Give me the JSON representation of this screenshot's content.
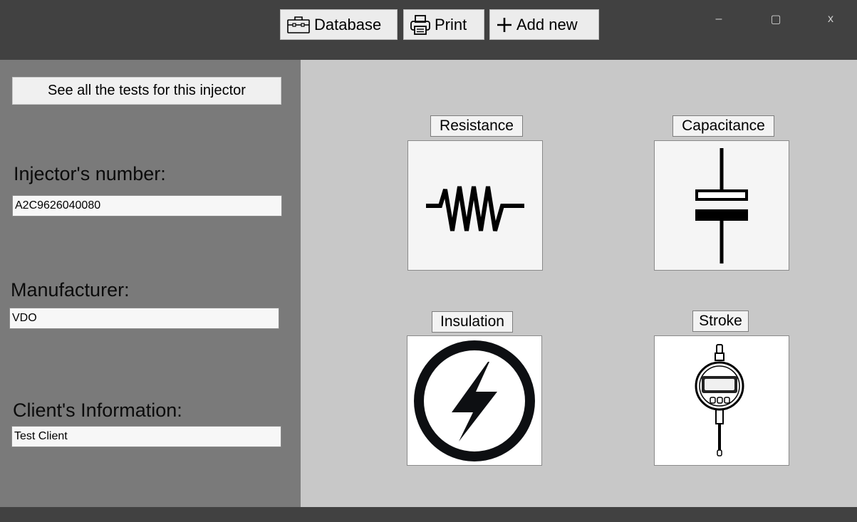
{
  "toolbar": {
    "database_label": "Database",
    "print_label": "Print",
    "add_new_label": "Add new"
  },
  "window_controls": {
    "minimize": "–",
    "maximize": "▢",
    "close": "x"
  },
  "left": {
    "see_all_label": "See all the tests for this injector",
    "injector_label": "Injector's number:",
    "injector_value": "A2C9626040080",
    "manufacturer_label": "Manufacturer:",
    "manufacturer_value": "VDO",
    "client_label": "Client's Information:",
    "client_value": "Test Client"
  },
  "tests": {
    "resistance": {
      "label": "Resistance",
      "icon": "resistor-icon"
    },
    "capacitance": {
      "label": "Capacitance",
      "icon": "capacitor-icon"
    },
    "insulation": {
      "label": "Insulation",
      "icon": "lightning-circle-icon"
    },
    "stroke": {
      "label": "Stroke",
      "icon": "dial-indicator-icon"
    }
  },
  "colors": {
    "titlebar": "#414141",
    "left_panel": "#7a7a7a",
    "right_panel": "#c8c8c8",
    "button_bg": "#ececec"
  }
}
